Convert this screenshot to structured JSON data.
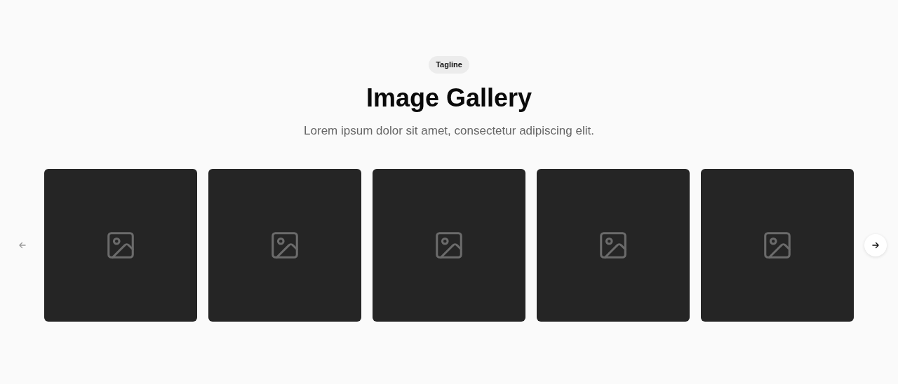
{
  "tagline": "Tagline",
  "title": "Image Gallery",
  "subtitle": "Lorem ipsum dolor sit amet, consectetur adipiscing elit.",
  "carousel": {
    "previous": {
      "disabled": true
    },
    "next": {
      "disabled": false
    },
    "images": [
      {
        "kind": "placeholder"
      },
      {
        "kind": "placeholder"
      },
      {
        "kind": "placeholder"
      },
      {
        "kind": "placeholder"
      },
      {
        "kind": "placeholder"
      }
    ]
  }
}
